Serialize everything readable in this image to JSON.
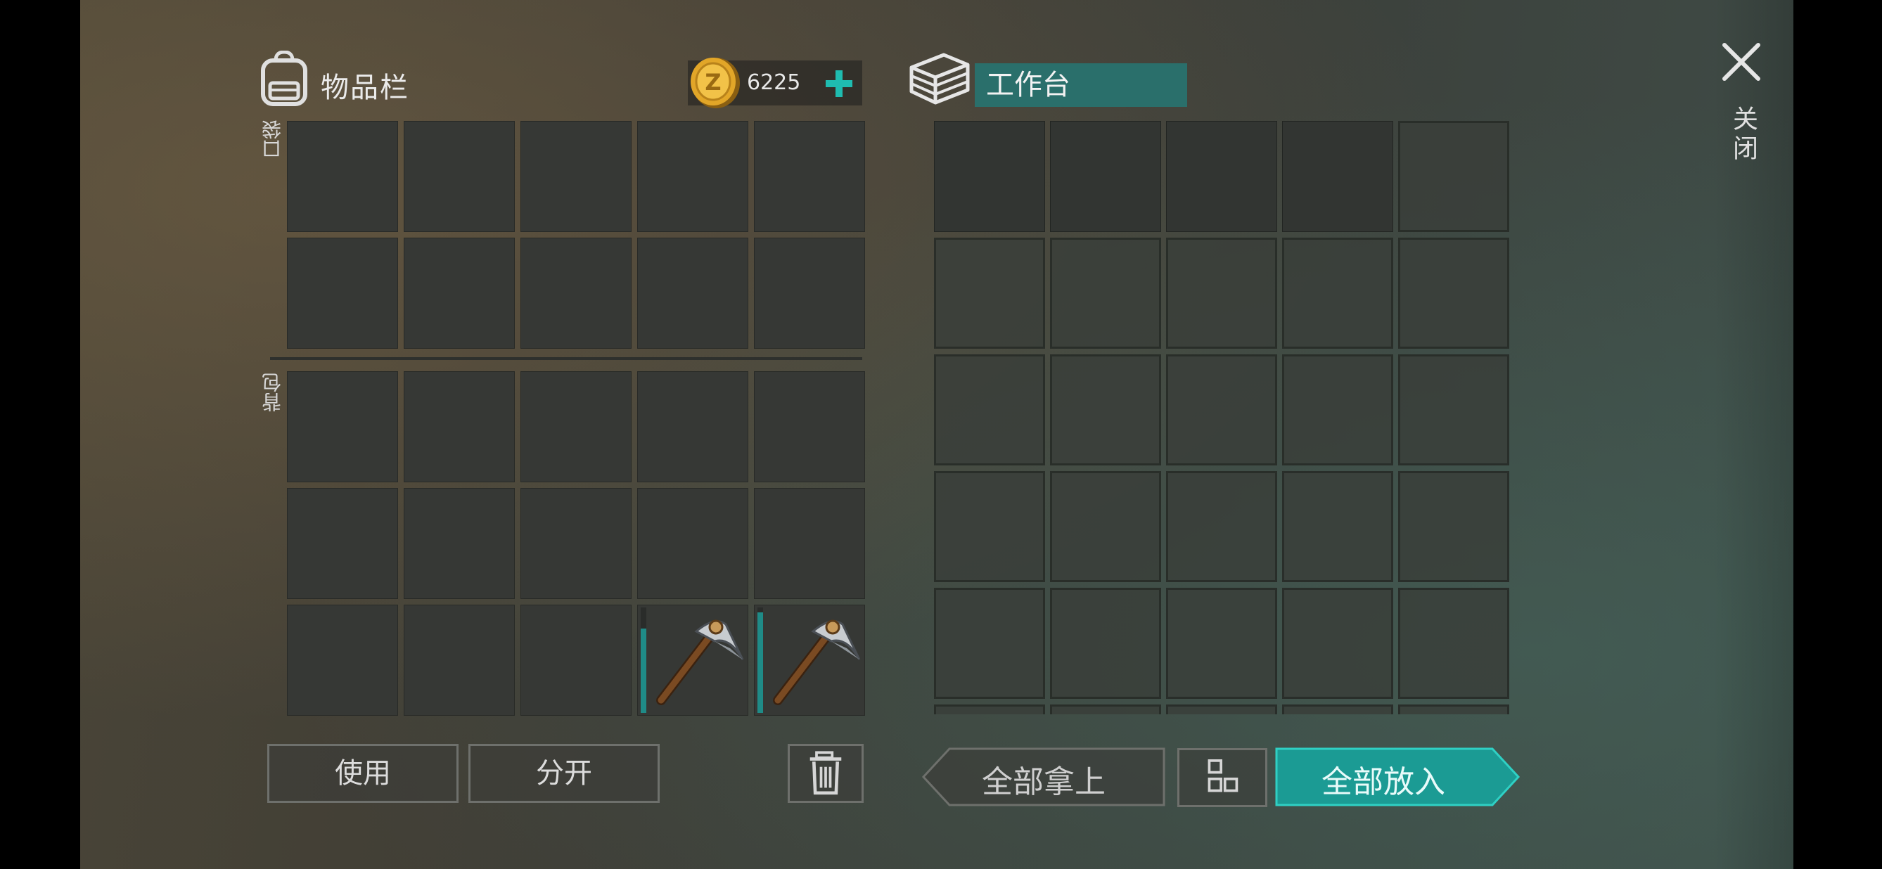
{
  "inventory": {
    "title": "物品栏",
    "pocket_label": "口袋",
    "backpack_label": "背包",
    "coins": "6225",
    "coin_add_icon": "plus-icon",
    "tools": [
      {
        "slot": "backpack-row3-col4",
        "icon": "pickaxe-icon",
        "durability": 0.8
      },
      {
        "slot": "backpack-row3-col5",
        "icon": "pickaxe-icon",
        "durability": 0.95
      }
    ]
  },
  "workbench": {
    "name": "工作台"
  },
  "close": {
    "label": "关闭",
    "icon": "close-icon"
  },
  "actions": {
    "use": "使用",
    "split": "分开",
    "take_all": "全部拿上",
    "put_all": "全部放入",
    "trash_icon": "trash-icon",
    "sort_icon": "grid-icon"
  },
  "colors": {
    "accent": "#1fbcb0",
    "accent_dark": "#2a6f6b",
    "durability": "#1f8b87"
  }
}
